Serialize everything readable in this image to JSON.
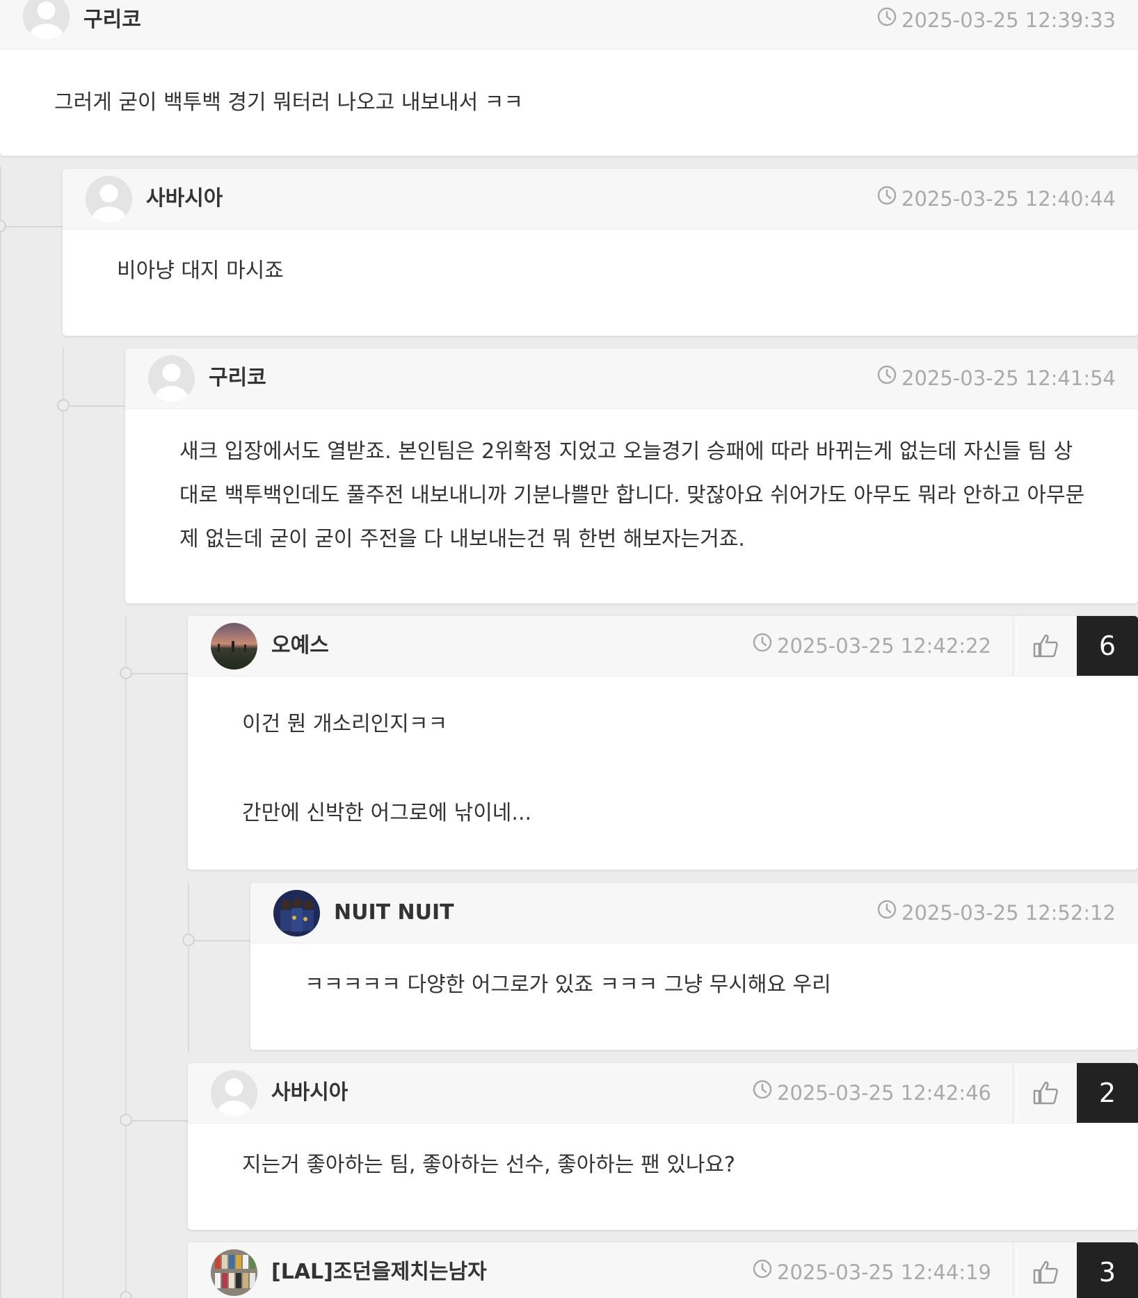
{
  "comments": [
    {
      "author": "구리코",
      "timestamp": "2025-03-25 12:39:33",
      "avatar": "default-avatar",
      "body": [
        "그러게 굳이 백투백 경기 뭐터러 나오고 내보내서 ㅋㅋ"
      ]
    },
    {
      "author": "사바시아",
      "timestamp": "2025-03-25 12:40:44",
      "avatar": "default-avatar",
      "body": [
        "비아냥 대지 마시죠"
      ]
    },
    {
      "author": "구리코",
      "timestamp": "2025-03-25 12:41:54",
      "avatar": "default-avatar",
      "body": [
        "새크 입장에서도 열받죠. 본인팀은 2위확정 지었고 오늘경기 승패에 따라 바뀌는게 없는데 자신들 팀 상대로 백투백인데도 풀주전 내보내니까 기분나쁠만 합니다. 맞잖아요 쉬어가도 아무도 뭐라 안하고 아무문제 없는데 굳이 굳이 주전을 다 내보내는건 뭐 한번 해보자는거죠."
      ]
    },
    {
      "author": "오예스",
      "timestamp": "2025-03-25 12:42:22",
      "avatar": "photo-avatar-sunset",
      "likes": "6",
      "body_first": "이건 뭔 개소리인지ㅋㅋ",
      "body_second": "간만에 신박한 어그로에 낚이네..."
    },
    {
      "author": "NUIT NUIT",
      "timestamp": "2025-03-25 12:52:12",
      "avatar": "photo-avatar-team",
      "body": [
        "ㅋㅋㅋㅋㅋ 다양한 어그로가 있죠 ㅋㅋㅋ 그냥 무시해요 우리"
      ]
    },
    {
      "author": "사바시아",
      "timestamp": "2025-03-25 12:42:46",
      "avatar": "default-avatar",
      "likes": "2",
      "body": [
        "지는거 좋아하는 팀, 좋아하는 선수, 좋아하는 팬 있나요?"
      ]
    },
    {
      "author": "[LAL]조던을제치는남자",
      "timestamp": "2025-03-25 12:44:19",
      "avatar": "photo-avatar-shelf",
      "likes": "3",
      "body": []
    }
  ],
  "icons": {
    "clock": "clock-icon",
    "like": "thumbs-up-icon",
    "avatar_default": "user-silhouette-icon"
  },
  "colors": {
    "page_background": "#ececec",
    "card_background": "#ffffff",
    "header_background": "#f7f7f7",
    "timestamp_text": "#aaaaaa",
    "count_badge": "#222222"
  }
}
